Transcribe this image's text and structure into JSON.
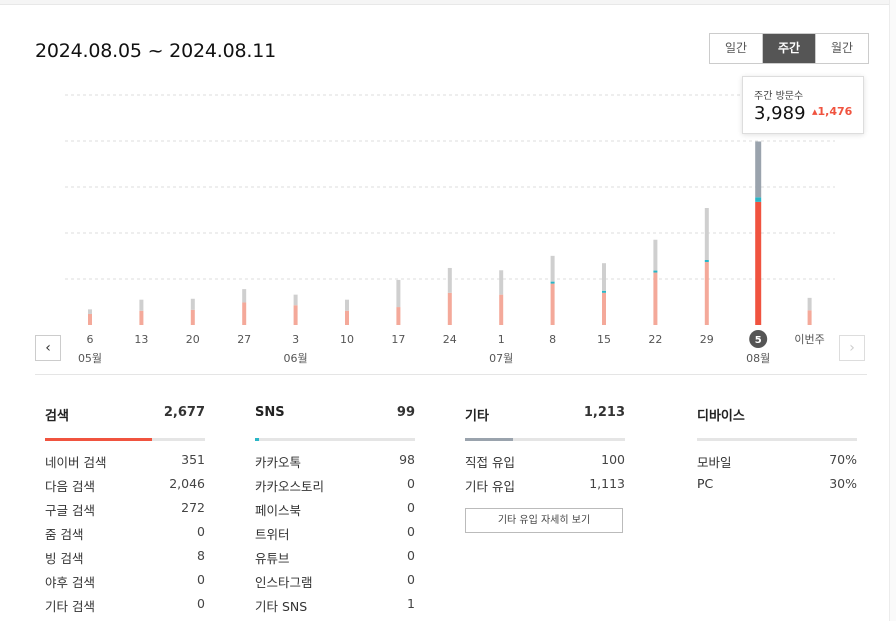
{
  "header": {
    "date_range": "2024.08.05 ~ 2024.08.11",
    "period_options": [
      "일간",
      "주간",
      "월간"
    ],
    "active_period": "주간"
  },
  "tooltip": {
    "label": "주간 방문수",
    "value": "3,989",
    "delta": "1,476"
  },
  "colors": {
    "search": "#f0533f",
    "search_light": "#f4a99a",
    "sns": "#29b6c6",
    "etc": "#9aa3ad",
    "etc_light": "#cfcfcf",
    "accent_dark": "#555555"
  },
  "chart_data": {
    "type": "bar",
    "stacked": true,
    "categories": [
      "6",
      "13",
      "20",
      "27",
      "3",
      "10",
      "17",
      "24",
      "1",
      "8",
      "15",
      "22",
      "29",
      "5",
      "이번주"
    ],
    "month_labels": [
      {
        "label": "05월",
        "at": "6"
      },
      {
        "label": "06월",
        "at": "3"
      },
      {
        "label": "07월",
        "at": "1"
      },
      {
        "label": "08월",
        "at": "5"
      }
    ],
    "selected": "5",
    "series": [
      {
        "key": "search",
        "values": [
          240,
          310,
          330,
          490,
          430,
          310,
          390,
          700,
          660,
          900,
          700,
          1140,
          1370,
          2677,
          320
        ]
      },
      {
        "key": "sns",
        "values": [
          0,
          0,
          0,
          0,
          0,
          0,
          0,
          0,
          0,
          35,
          35,
          35,
          35,
          99,
          0
        ]
      },
      {
        "key": "etc",
        "values": [
          100,
          240,
          240,
          290,
          230,
          240,
          590,
          540,
          530,
          560,
          600,
          670,
          1130,
          1213,
          270
        ]
      }
    ],
    "grid": true,
    "ylim": [
      0,
      5000
    ]
  },
  "stats": {
    "search": {
      "title": "검색",
      "total": "2,677",
      "rows": [
        {
          "label": "네이버 검색",
          "value": "351"
        },
        {
          "label": "다음 검색",
          "value": "2,046"
        },
        {
          "label": "구글 검색",
          "value": "272"
        },
        {
          "label": "줌 검색",
          "value": "0"
        },
        {
          "label": "빙 검색",
          "value": "8"
        },
        {
          "label": "야후 검색",
          "value": "0"
        },
        {
          "label": "기타 검색",
          "value": "0"
        }
      ]
    },
    "sns": {
      "title": "SNS",
      "total": "99",
      "rows": [
        {
          "label": "카카오톡",
          "value": "98"
        },
        {
          "label": "카카오스토리",
          "value": "0"
        },
        {
          "label": "페이스북",
          "value": "0"
        },
        {
          "label": "트위터",
          "value": "0"
        },
        {
          "label": "유튜브",
          "value": "0"
        },
        {
          "label": "인스타그램",
          "value": "0"
        },
        {
          "label": "기타 SNS",
          "value": "1"
        }
      ]
    },
    "etc": {
      "title": "기타",
      "total": "1,213",
      "rows": [
        {
          "label": "직접 유입",
          "value": "100"
        },
        {
          "label": "기타 유입",
          "value": "1,113"
        }
      ],
      "detail_button": "기타 유입 자세히 보기"
    },
    "device": {
      "title": "디바이스",
      "rows": [
        {
          "label": "모바일",
          "value": "70%"
        },
        {
          "label": "PC",
          "value": "30%"
        }
      ]
    },
    "share": {
      "search": 0.67,
      "sns": 0.025,
      "etc": 0.3
    }
  },
  "nav": {
    "prev": "‹",
    "next": "›"
  }
}
